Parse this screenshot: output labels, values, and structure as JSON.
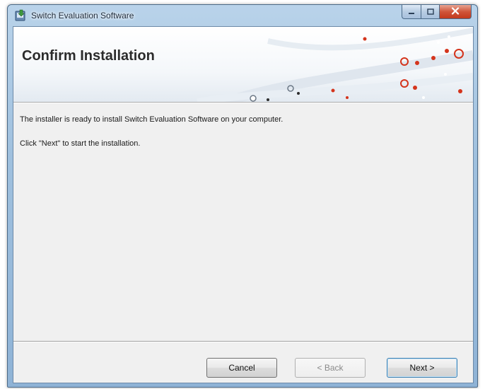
{
  "window": {
    "title": "Switch Evaluation Software",
    "icon": "installer-icon",
    "caption_buttons": [
      "minimize-icon",
      "maximize-icon",
      "close-icon"
    ]
  },
  "banner": {
    "title": "Confirm Installation"
  },
  "body": {
    "line1": "The installer is ready to install Switch Evaluation Software on your computer.",
    "line2": "Click \"Next\" to start the installation."
  },
  "buttons": {
    "cancel": "Cancel",
    "back": "< Back",
    "next": "Next >"
  },
  "colors": {
    "titlebar": "#9fc0de",
    "close": "#c2391c",
    "dot_red": "#d4341c",
    "dot_white": "#ffffff"
  }
}
